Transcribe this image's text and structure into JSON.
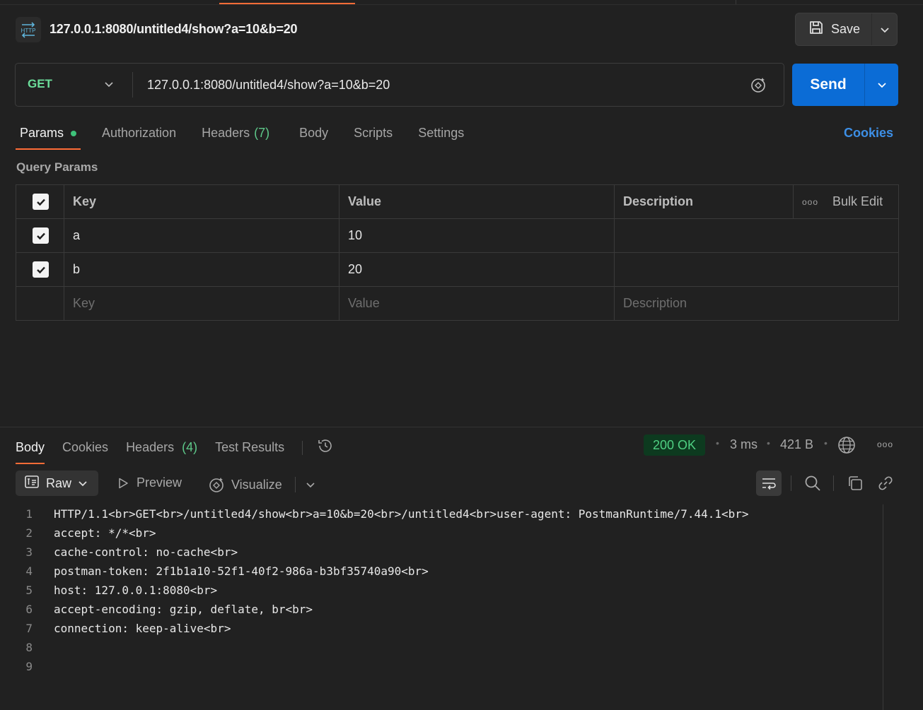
{
  "header": {
    "icon": "http-icon",
    "title": "127.0.0.1:8080/untitled4/show?a=10&b=20",
    "save_label": "Save"
  },
  "request": {
    "method": "GET",
    "url": "127.0.0.1:8080/untitled4/show?a=10&b=20",
    "send_label": "Send"
  },
  "tabs": {
    "params": "Params",
    "authorization": "Authorization",
    "headers": "Headers",
    "headers_count": "(7)",
    "body": "Body",
    "scripts": "Scripts",
    "settings": "Settings",
    "cookies": "Cookies"
  },
  "query_params": {
    "section_title": "Query Params",
    "columns": {
      "key": "Key",
      "value": "Value",
      "description": "Description",
      "bulk_edit": "Bulk Edit"
    },
    "rows": [
      {
        "key": "a",
        "value": "10",
        "description": "",
        "checked": true
      },
      {
        "key": "b",
        "value": "20",
        "description": "",
        "checked": true
      }
    ],
    "placeholders": {
      "key": "Key",
      "value": "Value",
      "description": "Description"
    }
  },
  "response": {
    "tabs": {
      "body": "Body",
      "cookies": "Cookies",
      "headers": "Headers",
      "headers_count": "(4)",
      "test_results": "Test Results"
    },
    "status": "200 OK",
    "time": "3 ms",
    "size": "421 B",
    "format": "Raw",
    "preview_label": "Preview",
    "visualize_label": "Visualize",
    "lines": [
      "HTTP/1.1<br>GET<br>/untitled4/show<br>a=10&b=20<br>/untitled4<br>user-agent: PostmanRuntime/7.44.1<br>",
      "accept: */*<br>",
      "cache-control: no-cache<br>",
      "postman-token: 2f1b1a10-52f1-40f2-986a-b3bf35740a90<br>",
      "host: 127.0.0.1:8080<br>",
      "accept-encoding: gzip, deflate, br<br>",
      "connection: keep-alive<br>",
      "",
      ""
    ]
  },
  "colors": {
    "background": "#212121",
    "accent_orange": "#ff6c37",
    "send_blue": "#0b6cd6",
    "method_green": "#6bdd9a",
    "status_green": "#4fd082"
  }
}
